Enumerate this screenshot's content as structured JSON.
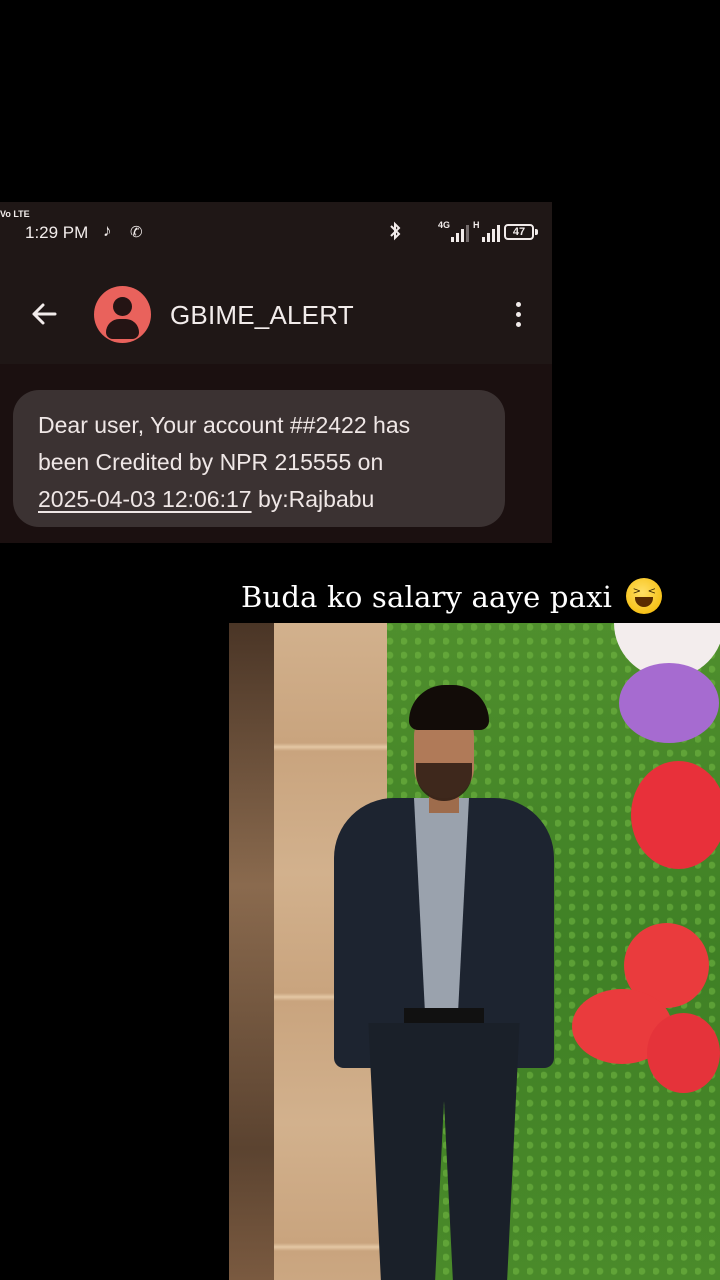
{
  "status_bar": {
    "time": "1:29 PM",
    "volte": "Vo LTE",
    "network_1": "4G",
    "network_2": "H",
    "battery": "47"
  },
  "app_bar": {
    "sender": "GBIME_ALERT"
  },
  "message": {
    "line1": "Dear user, Your account ##2422 has",
    "line2": "been Credited by NPR 215555 on",
    "date": "2025-04-03 12:06:17",
    "line3_suffix": " by:Rajbabu"
  },
  "caption": {
    "text": "Buda ko salary aaye paxi"
  },
  "colors": {
    "screen_bg": "#1f1716",
    "bubble_bg": "#3b3232",
    "avatar_bg": "#e9625c",
    "page_bg": "#000000"
  },
  "icons": {
    "tiktok": "tiktok-icon",
    "viber": "viber-icon",
    "bluetooth": "bluetooth-icon",
    "back": "arrow-back-icon",
    "more": "more-vert-icon",
    "emoji": "grinning-squinting-face-emoji"
  }
}
